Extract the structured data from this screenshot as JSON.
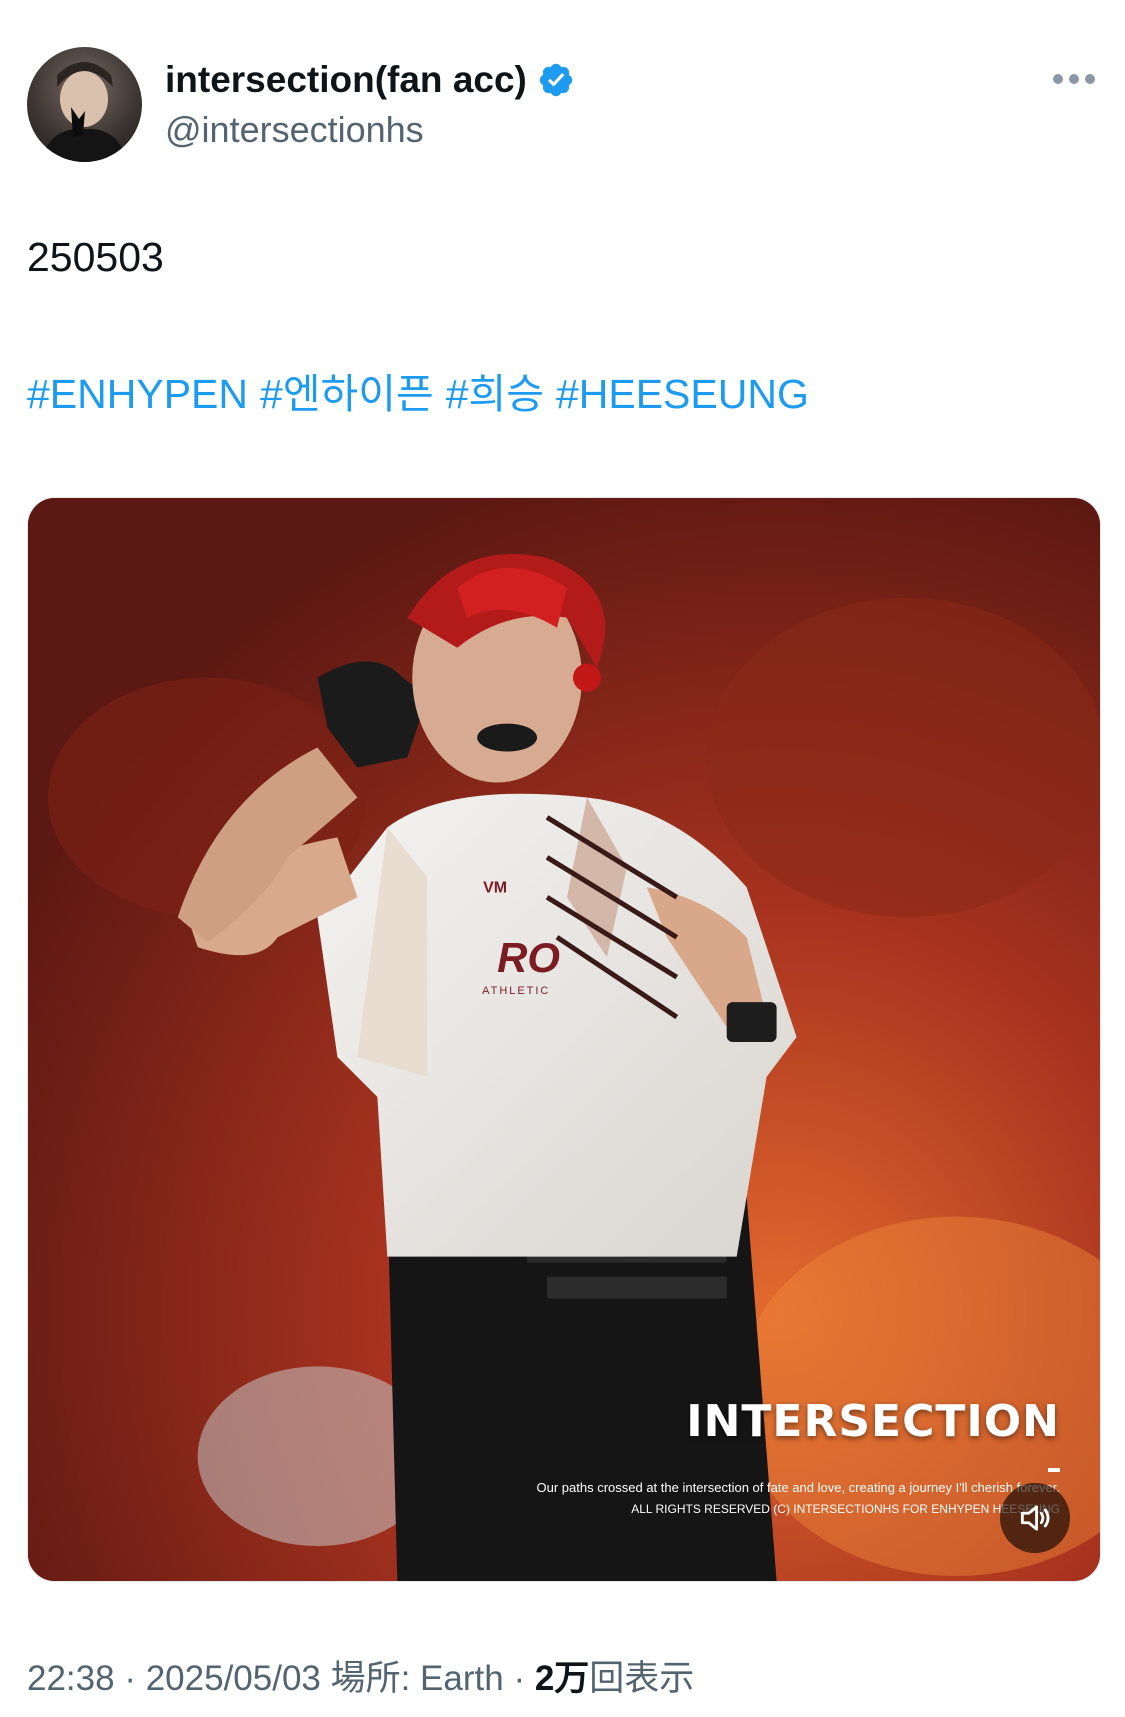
{
  "header": {
    "display_name": "intersection(fan acc)",
    "handle": "@intersectionhs",
    "verified": true
  },
  "tweet": {
    "text": "250503",
    "hashtags": [
      "#ENHYPEN",
      "#엔하이픈",
      "#희승",
      "#HEESEUNG"
    ]
  },
  "media": {
    "watermark_title": "INTERSECTION",
    "watermark_line1": "Our paths crossed at the intersection of fate and love, creating a journey I'll cherish forever.",
    "watermark_line2": "ALL RIGHTS RESERVED (C) INTERSECTIONHS FOR ENHYPEN HEESEUNG",
    "mute_icon": "speaker-muted-icon"
  },
  "meta": {
    "time": "22:38",
    "date": "2025/05/03",
    "location_label": "場所: Earth",
    "views_count": "2万",
    "views_label": "回表示",
    "separator": " · "
  },
  "colors": {
    "accent": "#1d9bf0",
    "text": "#0f1419",
    "secondary": "#536471"
  }
}
